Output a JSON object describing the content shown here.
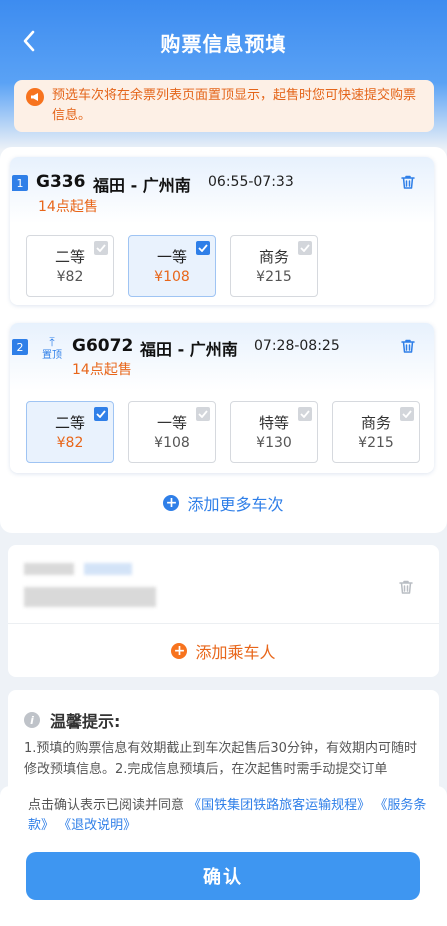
{
  "nav": {
    "title": "购票信息预填"
  },
  "notice": {
    "text": "预选车次将在余票列表页面置顶显示，起售时您可快速提交购票信息。"
  },
  "trains": [
    {
      "index": "1",
      "train_no": "G336",
      "route": "福田 - 广州南",
      "time": "06:55-07:33",
      "sale": "14点起售",
      "seats": [
        {
          "name": "二等",
          "price": "¥82",
          "selected": false
        },
        {
          "name": "一等",
          "price": "¥108",
          "selected": true
        },
        {
          "name": "商务",
          "price": "¥215",
          "selected": false
        }
      ]
    },
    {
      "index": "2",
      "pin_label": "置顶",
      "train_no": "G6072",
      "route": "福田 - 广州南",
      "time": "07:28-08:25",
      "sale": "14点起售",
      "seats": [
        {
          "name": "二等",
          "price": "¥82",
          "selected": true
        },
        {
          "name": "一等",
          "price": "¥108",
          "selected": false
        },
        {
          "name": "特等",
          "price": "¥130",
          "selected": false
        },
        {
          "name": "商务",
          "price": "¥215",
          "selected": false
        }
      ]
    }
  ],
  "add_train": {
    "label": "添加更多车次"
  },
  "passenger": {
    "add_label": "添加乘车人"
  },
  "tips": {
    "title": "温馨提示:",
    "body": "1.预填的购票信息有效期截止到车次起售后30分钟，有效期内可随时修改预填信息。2.完成信息预填后，在次起售时需手动提交订单"
  },
  "agreement": {
    "prefix": "点击确认表示已阅读并同意",
    "link1": "《国铁集团铁路旅客运输规程》",
    "link2": "《服务条款》",
    "link3": "《退改说明》"
  },
  "confirm": {
    "label": "确认"
  },
  "colors": {
    "primary": "#2f7fe8",
    "accent": "#e8661a",
    "notice_bg": "#fdf0e6"
  }
}
